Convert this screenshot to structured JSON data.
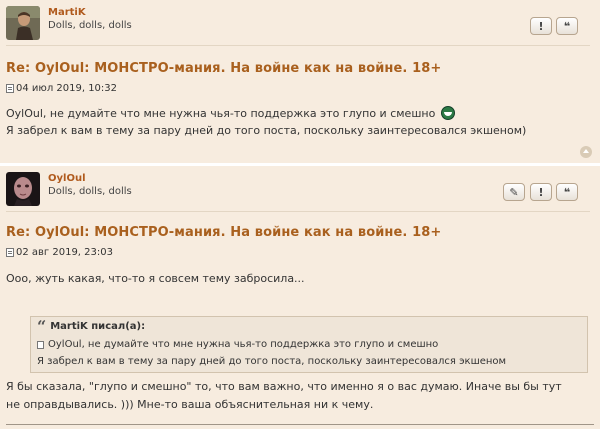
{
  "posts": [
    {
      "author": {
        "name": "MartiK",
        "rank": "Dolls, dolls, dolls"
      },
      "buttons": {
        "report": "!",
        "quote": "❝"
      },
      "title": "Re: OylOul: МОНСТРО-мания. На войне как на войне. 18+",
      "date": "04 июл 2019, 10:32",
      "body": {
        "line1_name": "OylOul",
        "line1_text": ", не думайте что мне нужна чья-то поддержка это глупо и смешно",
        "line2": "Я забрел к вам в тему за пару дней до того поста, поскольку заинтересовался экшеном)"
      }
    },
    {
      "author": {
        "name": "OylOul",
        "rank": "Dolls, dolls, dolls"
      },
      "buttons": {
        "edit": "✎",
        "report": "!",
        "quote": "❝"
      },
      "title": "Re: OylOul: МОНСТРО-мания. На войне как на войне. 18+",
      "date": "02 авг 2019, 23:03",
      "body": {
        "line1": "Ооо, жуть какая, что-то я совсем тему забросила...",
        "quote": {
          "header": "MartiK писал(а):",
          "line1_name": "OylOul",
          "line1_text": ", не думайте что мне нужна чья-то поддержка это глупо и смешно",
          "line2": "Я забрел к вам в тему за пару дней до того поста, поскольку заинтересовался экшеном"
        },
        "line2": "Я бы сказала, \"глупо и смешно\" то, что вам важно, что именно я о вас думаю. Иначе вы бы тут",
        "line3": "не оправдывались. ))) Мне-то ваша объяснительная ни к чему."
      }
    }
  ]
}
